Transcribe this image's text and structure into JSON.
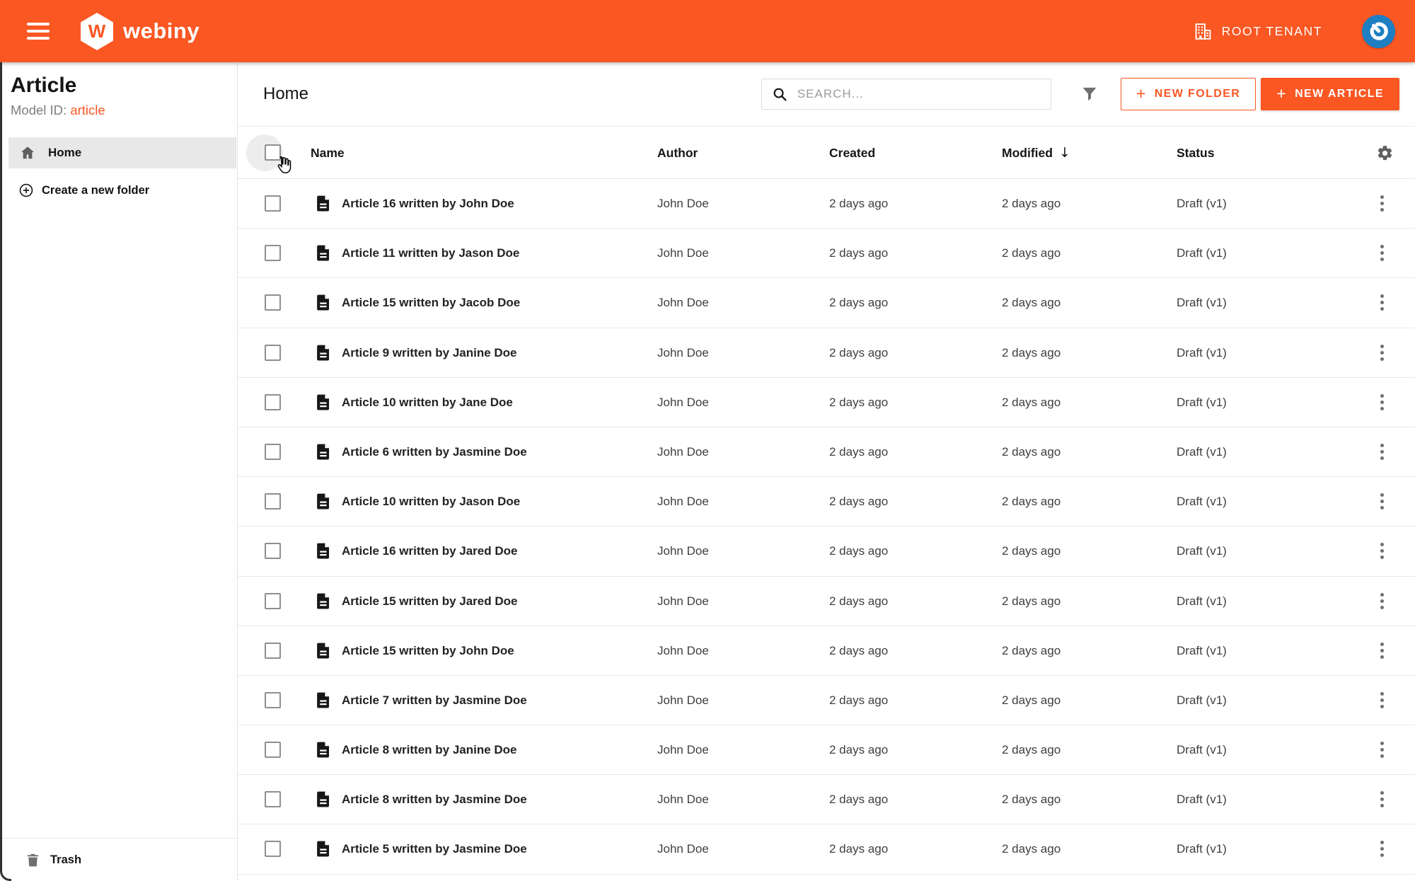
{
  "colors": {
    "primary": "#fa5723",
    "avatar_bg": "#1d7fc2"
  },
  "topbar": {
    "brand": "webiny",
    "brand_initial": "W",
    "tenant": "ROOT TENANT"
  },
  "sidebar": {
    "title": "Article",
    "model_id_label": "Model ID:",
    "model_id_value": "article",
    "home": "Home",
    "create_folder": "Create a new folder",
    "trash": "Trash"
  },
  "content_header": {
    "breadcrumb": "Home",
    "search_placeholder": "SEARCH...",
    "plus": "+",
    "new_folder": "NEW FOLDER",
    "new_article": "NEW ARTICLE"
  },
  "table": {
    "columns": {
      "name": "Name",
      "author": "Author",
      "created": "Created",
      "modified": "Modified",
      "status": "Status"
    },
    "sort_arrow": "↓",
    "rows": [
      {
        "name": "Article 16 written by John Doe",
        "author": "John Doe",
        "created": "2 days ago",
        "modified": "2 days ago",
        "status": "Draft (v1)"
      },
      {
        "name": "Article 11 written by Jason Doe",
        "author": "John Doe",
        "created": "2 days ago",
        "modified": "2 days ago",
        "status": "Draft (v1)"
      },
      {
        "name": "Article 15 written by Jacob Doe",
        "author": "John Doe",
        "created": "2 days ago",
        "modified": "2 days ago",
        "status": "Draft (v1)"
      },
      {
        "name": "Article 9 written by Janine Doe",
        "author": "John Doe",
        "created": "2 days ago",
        "modified": "2 days ago",
        "status": "Draft (v1)"
      },
      {
        "name": "Article 10 written by Jane Doe",
        "author": "John Doe",
        "created": "2 days ago",
        "modified": "2 days ago",
        "status": "Draft (v1)"
      },
      {
        "name": "Article 6 written by Jasmine Doe",
        "author": "John Doe",
        "created": "2 days ago",
        "modified": "2 days ago",
        "status": "Draft (v1)"
      },
      {
        "name": "Article 10 written by Jason Doe",
        "author": "John Doe",
        "created": "2 days ago",
        "modified": "2 days ago",
        "status": "Draft (v1)"
      },
      {
        "name": "Article 16 written by Jared Doe",
        "author": "John Doe",
        "created": "2 days ago",
        "modified": "2 days ago",
        "status": "Draft (v1)"
      },
      {
        "name": "Article 15 written by Jared Doe",
        "author": "John Doe",
        "created": "2 days ago",
        "modified": "2 days ago",
        "status": "Draft (v1)"
      },
      {
        "name": "Article 15 written by John Doe",
        "author": "John Doe",
        "created": "2 days ago",
        "modified": "2 days ago",
        "status": "Draft (v1)"
      },
      {
        "name": "Article 7 written by Jasmine Doe",
        "author": "John Doe",
        "created": "2 days ago",
        "modified": "2 days ago",
        "status": "Draft (v1)"
      },
      {
        "name": "Article 8 written by Janine Doe",
        "author": "John Doe",
        "created": "2 days ago",
        "modified": "2 days ago",
        "status": "Draft (v1)"
      },
      {
        "name": "Article 8 written by Jasmine Doe",
        "author": "John Doe",
        "created": "2 days ago",
        "modified": "2 days ago",
        "status": "Draft (v1)"
      },
      {
        "name": "Article 5 written by Jasmine Doe",
        "author": "John Doe",
        "created": "2 days ago",
        "modified": "2 days ago",
        "status": "Draft (v1)"
      }
    ]
  }
}
